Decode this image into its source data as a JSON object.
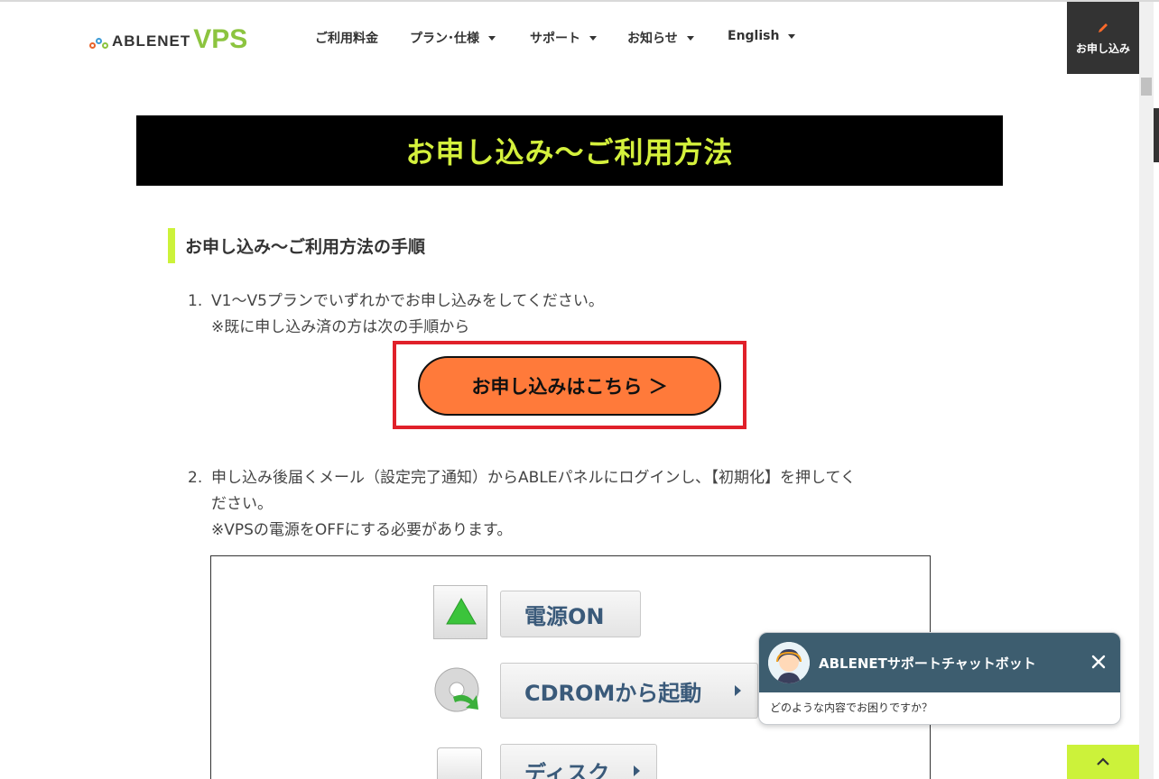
{
  "header": {
    "logo_text": "ABLENET",
    "logo_vps": "VPS",
    "nav": [
      {
        "label": "ご利用料金",
        "dropdown": false
      },
      {
        "label": "プラン･仕様",
        "dropdown": true
      },
      {
        "label": "サポート",
        "dropdown": true
      },
      {
        "label": "お知らせ",
        "dropdown": true
      },
      {
        "label": "English",
        "dropdown": true
      }
    ],
    "apply_label": "お申し込み"
  },
  "banner": {
    "title": "お申し込み～ご利用方法"
  },
  "section": {
    "heading": "お申し込み～ご利用方法の手順"
  },
  "steps": [
    {
      "num": "1.",
      "lines": [
        "V1～V5プランでいずれかでお申し込みをしてください。",
        "※既に申し込み済の方は次の手順から"
      ]
    },
    {
      "num": "2.",
      "lines": [
        "申し込み後届くメール（設定完了通知）からABLEパネルにログインし､【初期化】を押してく",
        "ださい。",
        "※VPSの電源をOFFにする必要があります。"
      ]
    }
  ],
  "cta": {
    "label": "お申し込みはこちら ＞"
  },
  "panel": {
    "buttons": [
      {
        "label": "電源ON",
        "has_arrow": false
      },
      {
        "label": "CDROMから起動",
        "has_arrow": true
      },
      {
        "label": "ディスク",
        "has_arrow": true
      }
    ]
  },
  "chat": {
    "title": "ABLENETサポートチャットボット",
    "message": "どのような内容でお困りですか？"
  },
  "colors": {
    "accent_green": "#ccf23a",
    "banner_text": "#d4f03c",
    "cta_orange": "#ff7a3a",
    "highlight_red": "#e0202a",
    "chat_header": "#3d5d6f"
  }
}
